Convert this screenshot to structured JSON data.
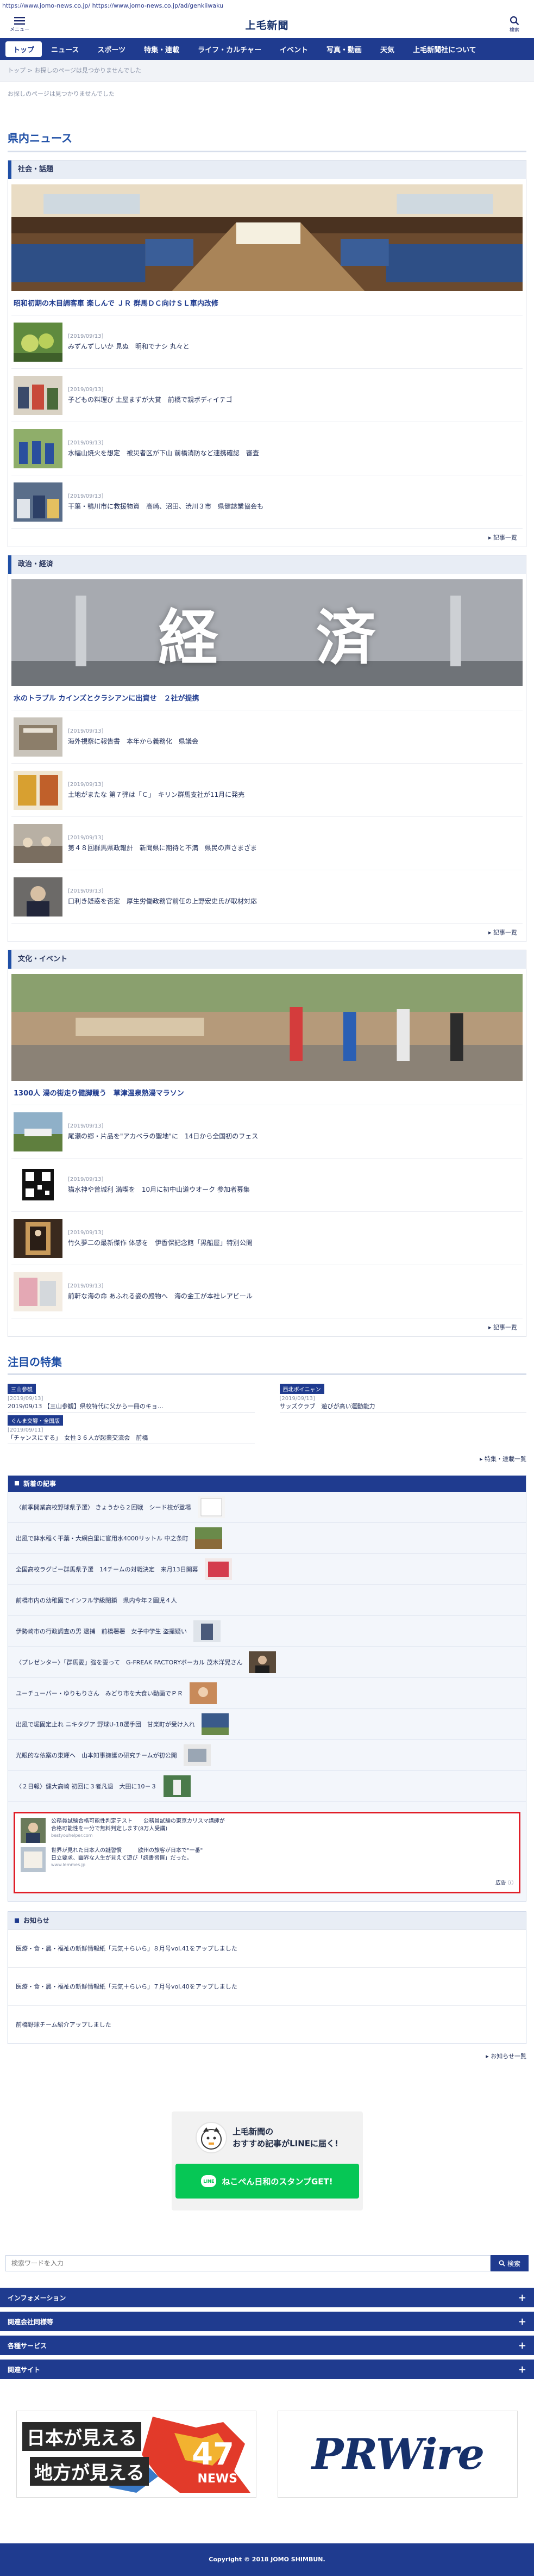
{
  "url": "https://www.jomo-news.co.jp/ https://www.jomo-news.co.jp/ad/genkiiwaku",
  "header": {
    "menu_label": "メニュー",
    "logo": "上毛新聞",
    "search_label": "検索"
  },
  "nav": [
    "トップ",
    "ニュース",
    "スポーツ",
    "特集・連載",
    "ライフ・カルチャー",
    "イベント",
    "写真・動画",
    "天気",
    "上毛新聞社について"
  ],
  "breadcrumb": "トップ > お探しのページは見つかりませんでした",
  "not_found": "お探しのページは見つかりませんでした",
  "prefecture_news_title": "県内ニュース",
  "categories": [
    {
      "name": "社会・話題",
      "hero_title": "昭和初期の木目調客車 楽しんで ＪＲ 群馬ＤＣ向けＳＬ車内改修",
      "articles": [
        {
          "date": "[2019/09/13]",
          "title": "みずんずしいか 見ぬ　明和でナシ 丸々と"
        },
        {
          "date": "[2019/09/13]",
          "title": "子どもの料理び 土屋まずが大賞　前橋で親ボディイテゴ"
        },
        {
          "date": "[2019/09/13]",
          "title": "水幅山焼火を想定　被災者区が下山 前橋消防など連携確認　審査"
        },
        {
          "date": "[2019/09/13]",
          "title": "干葉・鴨川市に救援物資　高崎、沼田、渋川３市　県健誌業協会も"
        }
      ],
      "more": "記事一覧"
    },
    {
      "name": "政治・経済",
      "hero_title": "水のトラブル カインズとクラシアンに出資せ　２社が提携",
      "articles": [
        {
          "date": "[2019/09/13]",
          "title": "海外視察に報告書　本年から義務化　県議会"
        },
        {
          "date": "[2019/09/13]",
          "title": "土地がまたな 第７弾は「Ｃ」　キリン群馬支社が11月に発売"
        },
        {
          "date": "[2019/09/13]",
          "title": "第４８回群馬県政報計　新聞県に期待と不満　県民の声さまざま"
        },
        {
          "date": "[2019/09/13]",
          "title": "口利き疑惑を否定　厚生労働政務官前任の上野宏史氏が取材対応"
        }
      ],
      "more": "記事一覧"
    },
    {
      "name": "文化・イベント",
      "hero_title": "1300人 湯の街走り健脚競う　草津温泉熱湯マラソン",
      "articles": [
        {
          "date": "[2019/09/13]",
          "title": "尾瀬の郷・片品を\"アカペラの聖地\"に　14日から全国初のフェス"
        },
        {
          "date": "[2019/09/13]",
          "title": "猫水神や曾城利 満喫を　10月に初中山道ウオーク 参加者募集"
        },
        {
          "date": "[2019/09/13]",
          "title": "竹久夢二の最新傑作 体感を　伊香保記念館「黒船屋」特別公開"
        },
        {
          "date": "[2019/09/13]",
          "title": "前軒な海の命 あふれる姿の殿物へ　海の金工が本社レアビール"
        }
      ],
      "more": "記事一覧"
    }
  ],
  "features": {
    "title": "注目の特集",
    "items": [
      {
        "tag": "三山参観",
        "date": "[2019/09/13]",
        "text": "2019/09/13 【三山参観】県校特代に父から一冊のキョ…"
      },
      {
        "tag": "西北ボイニャン",
        "date": "[2019/09/13]",
        "text": "サッズクラブ　遊びが高い運動能力"
      },
      {
        "tag": "ぐんま交響・全国版",
        "date": "[2019/09/11]",
        "text": "「チャンスにする」　女性３６人が起業交流会　前橋"
      }
    ],
    "more": "特集・連載一覧"
  },
  "latest": {
    "title": "新着の記事",
    "rows": [
      "〈前季開業高校野球県予選〉 きょうから２回戦　シード校が登場",
      "出風で鉢水稲く干葉・大網白里に官用水4000リットル 中之条町",
      "全国高校ラグビー群馬県予選　14チームの対戦決定　来月13日開幕",
      "前橋市内の幼稚園でインフル学級閉鎖　県内今年２園児４人",
      "伊勢崎市の行政調査の男 逮捕　前橋署署　女子中学生 盗撮疑い",
      "〈プレゼンター〉「群馬愛」強を誓って　G-FREAK FACTORYボーカル 茂木洋晃さん",
      "ユーチューバー・ゆりもりさん　みどり市を大食い動画でＰＲ",
      "出風で堀固定止れ ニキタグア 野球U-18選手団　甘楽町が受け入れ",
      "光眼的な依案の東輝へ　山本知事擁護の研究チームが初公開",
      "〈２日報〉健大高崎 初回に３者凡退　大田に10－３"
    ],
    "ad": {
      "items": [
        {
          "text": "公務員試験合格可能性判定テスト　　公務員試験の東京カリスマ講師が\n合格可能性を一分で無料判定します(8万人受講)",
          "source": "bestyouhelper.com"
        },
        {
          "text": "世界が見れた日本人の謎習慣　　　欧州の旅客が日本で\"一番\"\n日立要求、幽界な人生が見えて遊び「読書習慣」だった。",
          "source": "www.lemmes.jp"
        }
      ],
      "label": "広告"
    }
  },
  "notices": {
    "title": "お知らせ",
    "rows": [
      "医療・食・農・福祉の新鮮情報紙「元気＋らいら」８月号vol.41をアップしました",
      "医療・食・農・福祉の新鮮情報紙「元気＋らいら」７月号vol.40をアップしました",
      "前橋野球チーム紹介アップしました"
    ],
    "more": "お知らせ一覧"
  },
  "line_promo": {
    "line1": "上毛新聞の",
    "line2": "おすすめ記事がLINEに届く!",
    "button": "ねこぺん日和のスタンプGET!",
    "line_logo": "LINE"
  },
  "search": {
    "placeholder": "検索ワードを入力",
    "button": "検索"
  },
  "accordion": [
    "インフォメーション",
    "関連会社同様等",
    "各種サービス",
    "関連サイト"
  ],
  "banners": {
    "left_line1": "日本が見える",
    "left_line2": "地方が見える",
    "left_brand": "47",
    "left_brand_sub": "NEWS",
    "right": "PRWire"
  },
  "footer": "Copyright © 2018 JOMO SHIMBUN."
}
